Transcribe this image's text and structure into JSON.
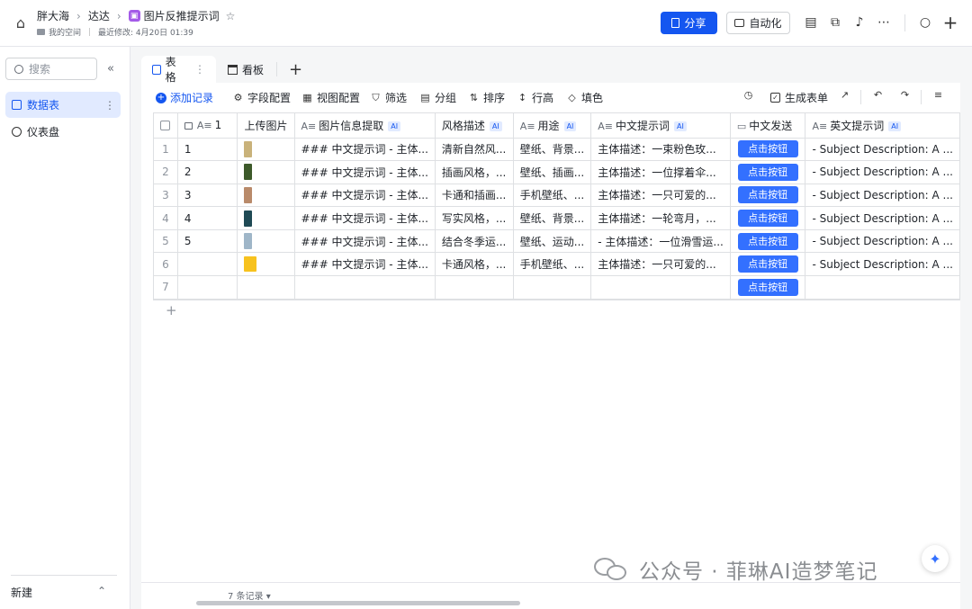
{
  "header": {
    "breadcrumbs": [
      "胖大海",
      "达达",
      "图片反推提示词"
    ],
    "location": "我的空间",
    "last_modified": "最近修改: 4月20日 01:39",
    "share_label": "分享",
    "automation_label": "自动化"
  },
  "sidebar": {
    "search_placeholder": "搜索",
    "items": [
      {
        "label": "数据表",
        "active": true
      },
      {
        "label": "仪表盘",
        "active": false
      }
    ],
    "new_label": "新建"
  },
  "tabs": [
    {
      "label": "表格",
      "active": true
    },
    {
      "label": "看板",
      "active": false
    }
  ],
  "toolbar": {
    "add_record": "添加记录",
    "field_config": "字段配置",
    "view_config": "视图配置",
    "filter": "筛选",
    "group": "分组",
    "sort": "排序",
    "row_height": "行高",
    "fill_color": "填色",
    "generate_form": "生成表单"
  },
  "table": {
    "columns": [
      "1",
      "上传图片",
      "图片信息提取",
      "风格描述",
      "用途",
      "中文提示词",
      "中文发送",
      "英文提示词"
    ],
    "ai_columns": [
      "图片信息提取",
      "风格描述",
      "用途",
      "中文提示词",
      "英文提示词"
    ],
    "button_label": "点击按钮",
    "rows": [
      {
        "num": "1",
        "id": "1",
        "image_color": "#c9b27a",
        "info": "### 中文提示词 - 主体...",
        "style": "清新自然风...",
        "use": "壁纸、背景...",
        "cn_prompt": "主体描述：一束粉色玫...",
        "en_prompt": "- Subject Description: A ..."
      },
      {
        "num": "2",
        "id": "2",
        "image_color": "#3d5a2a",
        "info": "### 中文提示词 - 主体...",
        "style": "插画风格，...",
        "use": "壁纸、插画...",
        "cn_prompt": "主体描述：一位撑着伞...",
        "en_prompt": "- Subject Description: A ..."
      },
      {
        "num": "3",
        "id": "3",
        "image_color": "#b98a6a",
        "info": "### 中文提示词 - 主体...",
        "style": "卡通和插画...",
        "use": "手机壁纸、...",
        "cn_prompt": "主体描述：一只可爱的...",
        "en_prompt": "- Subject Description: A ..."
      },
      {
        "num": "4",
        "id": "4",
        "image_color": "#1f4a55",
        "info": "### 中文提示词 - 主体...",
        "style": "写实风格，...",
        "use": "壁纸、背景...",
        "cn_prompt": "主体描述：一轮弯月，...",
        "en_prompt": "- Subject Description: A ..."
      },
      {
        "num": "5",
        "id": "5",
        "image_color": "#9fb6c8",
        "info": "### 中文提示词 - 主体...",
        "style": "结合冬季运...",
        "use": "壁纸、运动...",
        "cn_prompt": "- 主体描述：一位滑雪运...",
        "en_prompt": "- Subject Description: A ..."
      },
      {
        "num": "6",
        "id": "",
        "image_color": "#f7c21e",
        "info": "### 中文提示词 - 主体...",
        "style": "卡通风格，...",
        "use": "手机壁纸、...",
        "cn_prompt": "主体描述：一只可爱的...",
        "en_prompt": "- Subject Description: A ..."
      },
      {
        "num": "7",
        "id": "",
        "image_color": "",
        "info": "",
        "style": "",
        "use": "",
        "cn_prompt": "",
        "en_prompt": ""
      }
    ]
  },
  "footer": {
    "record_count": "7 条记录"
  },
  "watermark": "公众号 · 菲琳AI造梦笔记"
}
